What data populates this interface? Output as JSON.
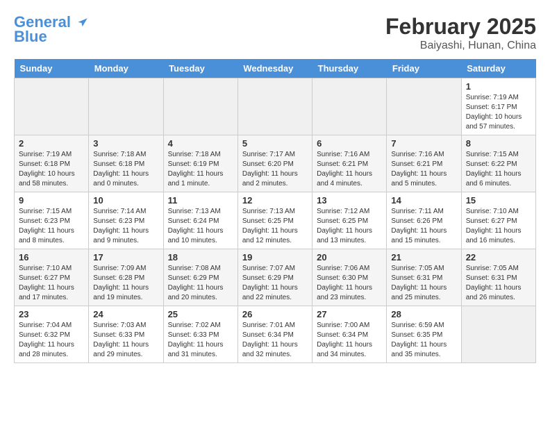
{
  "header": {
    "logo_line1": "General",
    "logo_line2": "Blue",
    "month": "February 2025",
    "location": "Baiyashi, Hunan, China"
  },
  "weekdays": [
    "Sunday",
    "Monday",
    "Tuesday",
    "Wednesday",
    "Thursday",
    "Friday",
    "Saturday"
  ],
  "weeks": [
    [
      {
        "day": "",
        "info": ""
      },
      {
        "day": "",
        "info": ""
      },
      {
        "day": "",
        "info": ""
      },
      {
        "day": "",
        "info": ""
      },
      {
        "day": "",
        "info": ""
      },
      {
        "day": "",
        "info": ""
      },
      {
        "day": "1",
        "info": "Sunrise: 7:19 AM\nSunset: 6:17 PM\nDaylight: 10 hours\nand 57 minutes."
      }
    ],
    [
      {
        "day": "2",
        "info": "Sunrise: 7:19 AM\nSunset: 6:18 PM\nDaylight: 10 hours\nand 58 minutes."
      },
      {
        "day": "3",
        "info": "Sunrise: 7:18 AM\nSunset: 6:18 PM\nDaylight: 11 hours\nand 0 minutes."
      },
      {
        "day": "4",
        "info": "Sunrise: 7:18 AM\nSunset: 6:19 PM\nDaylight: 11 hours\nand 1 minute."
      },
      {
        "day": "5",
        "info": "Sunrise: 7:17 AM\nSunset: 6:20 PM\nDaylight: 11 hours\nand 2 minutes."
      },
      {
        "day": "6",
        "info": "Sunrise: 7:16 AM\nSunset: 6:21 PM\nDaylight: 11 hours\nand 4 minutes."
      },
      {
        "day": "7",
        "info": "Sunrise: 7:16 AM\nSunset: 6:21 PM\nDaylight: 11 hours\nand 5 minutes."
      },
      {
        "day": "8",
        "info": "Sunrise: 7:15 AM\nSunset: 6:22 PM\nDaylight: 11 hours\nand 6 minutes."
      }
    ],
    [
      {
        "day": "9",
        "info": "Sunrise: 7:15 AM\nSunset: 6:23 PM\nDaylight: 11 hours\nand 8 minutes."
      },
      {
        "day": "10",
        "info": "Sunrise: 7:14 AM\nSunset: 6:23 PM\nDaylight: 11 hours\nand 9 minutes."
      },
      {
        "day": "11",
        "info": "Sunrise: 7:13 AM\nSunset: 6:24 PM\nDaylight: 11 hours\nand 10 minutes."
      },
      {
        "day": "12",
        "info": "Sunrise: 7:13 AM\nSunset: 6:25 PM\nDaylight: 11 hours\nand 12 minutes."
      },
      {
        "day": "13",
        "info": "Sunrise: 7:12 AM\nSunset: 6:25 PM\nDaylight: 11 hours\nand 13 minutes."
      },
      {
        "day": "14",
        "info": "Sunrise: 7:11 AM\nSunset: 6:26 PM\nDaylight: 11 hours\nand 15 minutes."
      },
      {
        "day": "15",
        "info": "Sunrise: 7:10 AM\nSunset: 6:27 PM\nDaylight: 11 hours\nand 16 minutes."
      }
    ],
    [
      {
        "day": "16",
        "info": "Sunrise: 7:10 AM\nSunset: 6:27 PM\nDaylight: 11 hours\nand 17 minutes."
      },
      {
        "day": "17",
        "info": "Sunrise: 7:09 AM\nSunset: 6:28 PM\nDaylight: 11 hours\nand 19 minutes."
      },
      {
        "day": "18",
        "info": "Sunrise: 7:08 AM\nSunset: 6:29 PM\nDaylight: 11 hours\nand 20 minutes."
      },
      {
        "day": "19",
        "info": "Sunrise: 7:07 AM\nSunset: 6:29 PM\nDaylight: 11 hours\nand 22 minutes."
      },
      {
        "day": "20",
        "info": "Sunrise: 7:06 AM\nSunset: 6:30 PM\nDaylight: 11 hours\nand 23 minutes."
      },
      {
        "day": "21",
        "info": "Sunrise: 7:05 AM\nSunset: 6:31 PM\nDaylight: 11 hours\nand 25 minutes."
      },
      {
        "day": "22",
        "info": "Sunrise: 7:05 AM\nSunset: 6:31 PM\nDaylight: 11 hours\nand 26 minutes."
      }
    ],
    [
      {
        "day": "23",
        "info": "Sunrise: 7:04 AM\nSunset: 6:32 PM\nDaylight: 11 hours\nand 28 minutes."
      },
      {
        "day": "24",
        "info": "Sunrise: 7:03 AM\nSunset: 6:33 PM\nDaylight: 11 hours\nand 29 minutes."
      },
      {
        "day": "25",
        "info": "Sunrise: 7:02 AM\nSunset: 6:33 PM\nDaylight: 11 hours\nand 31 minutes."
      },
      {
        "day": "26",
        "info": "Sunrise: 7:01 AM\nSunset: 6:34 PM\nDaylight: 11 hours\nand 32 minutes."
      },
      {
        "day": "27",
        "info": "Sunrise: 7:00 AM\nSunset: 6:34 PM\nDaylight: 11 hours\nand 34 minutes."
      },
      {
        "day": "28",
        "info": "Sunrise: 6:59 AM\nSunset: 6:35 PM\nDaylight: 11 hours\nand 35 minutes."
      },
      {
        "day": "",
        "info": ""
      }
    ]
  ]
}
